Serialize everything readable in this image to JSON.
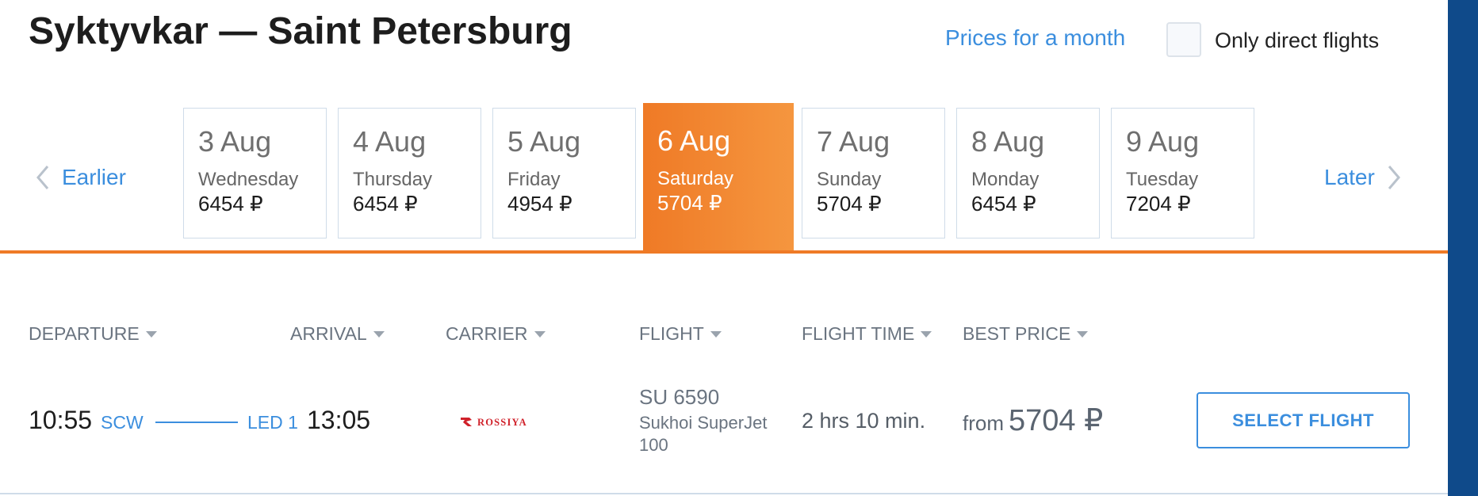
{
  "header": {
    "route_title": "Syktyvkar — Saint Petersburg",
    "prices_month_link": "Prices for a month",
    "direct_only_label": "Only direct flights",
    "direct_only_checked": false
  },
  "date_nav": {
    "earlier_label": "Earlier",
    "later_label": "Later",
    "days": [
      {
        "date": "3 Aug",
        "weekday": "Wednesday",
        "price": "6454 ₽",
        "active": false
      },
      {
        "date": "4 Aug",
        "weekday": "Thursday",
        "price": "6454 ₽",
        "active": false
      },
      {
        "date": "5 Aug",
        "weekday": "Friday",
        "price": "4954 ₽",
        "active": false
      },
      {
        "date": "6 Aug",
        "weekday": "Saturday",
        "price": "5704 ₽",
        "active": true
      },
      {
        "date": "7 Aug",
        "weekday": "Sunday",
        "price": "5704 ₽",
        "active": false
      },
      {
        "date": "8 Aug",
        "weekday": "Monday",
        "price": "6454 ₽",
        "active": false
      },
      {
        "date": "9 Aug",
        "weekday": "Tuesday",
        "price": "7204 ₽",
        "active": false
      }
    ]
  },
  "columns": {
    "departure": "DEPARTURE",
    "arrival": "ARRIVAL",
    "carrier": "CARRIER",
    "flight": "FLIGHT",
    "flight_time": "FLIGHT TIME",
    "best_price": "BEST PRICE"
  },
  "flights": [
    {
      "departure_time": "10:55",
      "departure_airport": "SCW",
      "arrival_airport": "LED 1",
      "arrival_time": "13:05",
      "carrier": "ROSSIYA",
      "flight_number": "SU 6590",
      "aircraft": "Sukhoi SuperJet 100",
      "duration": "2 hrs 10 min.",
      "price_prefix": "from",
      "price": "5704 ₽",
      "select_label": "SELECT FLIGHT"
    }
  ],
  "colors": {
    "accent_orange": "#ef7a26",
    "link_blue": "#3b8ede",
    "carrier_red": "#d0212a",
    "side_strip": "#0f4a8a"
  }
}
